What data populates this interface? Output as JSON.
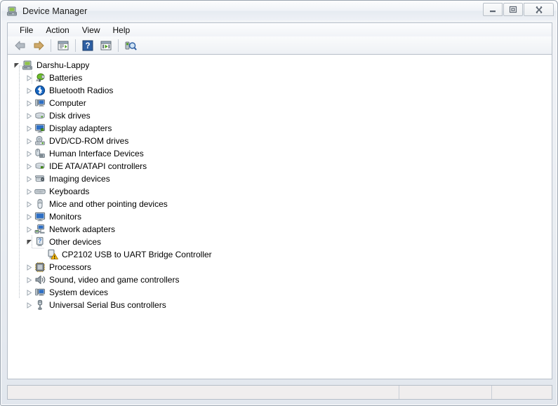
{
  "window": {
    "title": "Device Manager",
    "title_icon": "device-manager-icon",
    "caption_buttons": [
      {
        "name": "minimize-button",
        "glyph": "—"
      },
      {
        "name": "maximize-button",
        "glyph": "□"
      },
      {
        "name": "close-button",
        "glyph": "✕"
      }
    ]
  },
  "menubar": {
    "items": [
      {
        "label": "File",
        "name": "menu-file"
      },
      {
        "label": "Action",
        "name": "menu-action"
      },
      {
        "label": "View",
        "name": "menu-view"
      },
      {
        "label": "Help",
        "name": "menu-help"
      }
    ]
  },
  "toolbar": {
    "buttons": [
      {
        "name": "back-button",
        "icon": "back-arrow-icon"
      },
      {
        "name": "forward-button",
        "icon": "forward-arrow-icon"
      },
      {
        "name": "separator-1",
        "icon": "separator"
      },
      {
        "name": "properties-button",
        "icon": "properties-icon"
      },
      {
        "name": "separator-2",
        "icon": "separator"
      },
      {
        "name": "help-button",
        "icon": "help-question-icon"
      },
      {
        "name": "update-driver-button",
        "icon": "update-driver-icon"
      },
      {
        "name": "separator-3",
        "icon": "separator"
      },
      {
        "name": "scan-hardware-button",
        "icon": "scan-hardware-icon"
      }
    ]
  },
  "tree": {
    "root": {
      "label": "Darshu-Lappy",
      "icon": "computer-icon",
      "expanded": true,
      "level": 0
    },
    "nodes": [
      {
        "label": "Batteries",
        "icon": "battery-icon",
        "expanded": false,
        "level": 1
      },
      {
        "label": "Bluetooth Radios",
        "icon": "bluetooth-icon",
        "expanded": false,
        "level": 1
      },
      {
        "label": "Computer",
        "icon": "computer-node-icon",
        "expanded": false,
        "level": 1
      },
      {
        "label": "Disk drives",
        "icon": "disk-drive-icon",
        "expanded": false,
        "level": 1
      },
      {
        "label": "Display adapters",
        "icon": "display-adapter-icon",
        "expanded": false,
        "level": 1
      },
      {
        "label": "DVD/CD-ROM drives",
        "icon": "dvd-drive-icon",
        "expanded": false,
        "level": 1
      },
      {
        "label": "Human Interface Devices",
        "icon": "hid-icon",
        "expanded": false,
        "level": 1
      },
      {
        "label": "IDE ATA/ATAPI controllers",
        "icon": "ide-controller-icon",
        "expanded": false,
        "level": 1
      },
      {
        "label": "Imaging devices",
        "icon": "imaging-device-icon",
        "expanded": false,
        "level": 1
      },
      {
        "label": "Keyboards",
        "icon": "keyboard-icon",
        "expanded": false,
        "level": 1
      },
      {
        "label": "Mice and other pointing devices",
        "icon": "mouse-icon",
        "expanded": false,
        "level": 1
      },
      {
        "label": "Monitors",
        "icon": "monitor-icon",
        "expanded": false,
        "level": 1
      },
      {
        "label": "Network adapters",
        "icon": "network-adapter-icon",
        "expanded": false,
        "level": 1
      },
      {
        "label": "Other devices",
        "icon": "other-devices-icon",
        "expanded": true,
        "level": 1
      },
      {
        "label": "CP2102 USB to UART Bridge Controller",
        "icon": "unknown-device-warning-icon",
        "expanded": null,
        "level": 2
      },
      {
        "label": "Processors",
        "icon": "processor-icon",
        "expanded": false,
        "level": 1
      },
      {
        "label": "Sound, video and game controllers",
        "icon": "sound-controller-icon",
        "expanded": false,
        "level": 1
      },
      {
        "label": "System devices",
        "icon": "system-device-icon",
        "expanded": false,
        "level": 1
      },
      {
        "label": "Universal Serial Bus controllers",
        "icon": "usb-controller-icon",
        "expanded": false,
        "level": 1
      }
    ]
  },
  "statusbar": {
    "panes": [
      "",
      "",
      ""
    ]
  },
  "colors": {
    "window_frame": "#9aa4b0",
    "titlebar_top": "#fbfcfd",
    "toolbar_bg": "#f1f3f7",
    "tree_bg": "#ffffff",
    "statusbar_bg": "#f0eeee",
    "warning_yellow": "#ffc20e",
    "bluetooth_blue": "#1565c0",
    "accent_green": "#4a9e18"
  }
}
